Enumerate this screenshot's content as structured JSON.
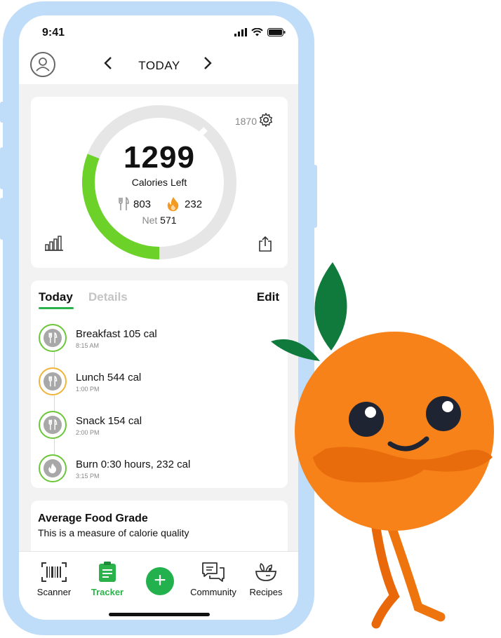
{
  "status": {
    "time": "9:41"
  },
  "nav": {
    "title": "TODAY",
    "prev_icon": "chevron-left-icon",
    "next_icon": "chevron-right-icon"
  },
  "calories": {
    "goal": "1870",
    "left": "1299",
    "left_label": "Calories Left",
    "food": "803",
    "burned": "232",
    "net_label": "Net",
    "net": "571",
    "ring_progress": 0.31,
    "colors": {
      "ring_fill": "#6cd22a",
      "ring_track": "#e6e6e6",
      "flame": "#f39a20"
    }
  },
  "log": {
    "tabs": {
      "today": "Today",
      "details": "Details"
    },
    "edit": "Edit",
    "entries": [
      {
        "name": "Breakfast",
        "value": "105 cal",
        "time": "8:15 AM",
        "icon": "fork-knife-icon"
      },
      {
        "name": "Lunch",
        "value": "544 cal",
        "time": "1:00 PM",
        "icon": "fork-knife-icon"
      },
      {
        "name": "Snack",
        "value": "154 cal",
        "time": "2:00 PM",
        "icon": "fork-knife-icon"
      },
      {
        "name": "Burn",
        "value": "0:30 hours, 232 cal",
        "time": "3:15 PM",
        "icon": "flame-icon"
      }
    ]
  },
  "grade": {
    "title": "Average Food Grade",
    "subtitle": "This is a measure of calorie quality"
  },
  "tabbar": {
    "scanner": "Scanner",
    "tracker": "Tracker",
    "add": "+",
    "community": "Community",
    "recipes": "Recipes",
    "accent": "#2bb24a"
  }
}
